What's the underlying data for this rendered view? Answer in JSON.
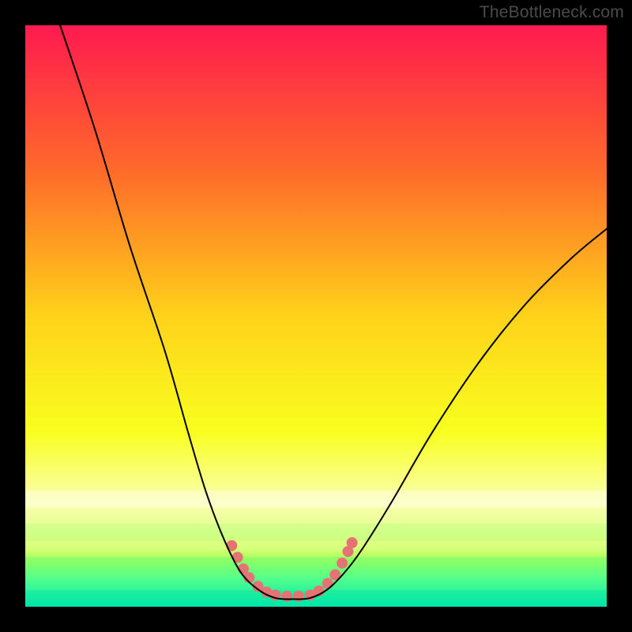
{
  "watermark": "TheBottleneck.com",
  "chart_data": {
    "type": "line",
    "title": "",
    "xlabel": "",
    "ylabel": "",
    "xlim": [
      0,
      100
    ],
    "ylim": [
      0,
      100
    ],
    "background_gradient": {
      "stops": [
        {
          "offset": 0.0,
          "color": "#ff1a4f"
        },
        {
          "offset": 0.25,
          "color": "#ff6a2a"
        },
        {
          "offset": 0.5,
          "color": "#ffd21a"
        },
        {
          "offset": 0.7,
          "color": "#f8ff1f"
        },
        {
          "offset": 0.82,
          "color": "#faffb0"
        },
        {
          "offset": 0.9,
          "color": "#d8ff7a"
        },
        {
          "offset": 0.92,
          "color": "#a8ff55"
        },
        {
          "offset": 0.95,
          "color": "#55ff8a"
        },
        {
          "offset": 1.0,
          "color": "#00e8b0"
        }
      ]
    },
    "green_band": {
      "y0": 94,
      "y1": 100
    },
    "series": [
      {
        "name": "bottleneck-curve",
        "type": "line",
        "stroke": "#000000",
        "stroke_width": 2,
        "points": [
          {
            "x": 6,
            "y": 100
          },
          {
            "x": 12,
            "y": 82
          },
          {
            "x": 18,
            "y": 62
          },
          {
            "x": 24,
            "y": 44
          },
          {
            "x": 28,
            "y": 30
          },
          {
            "x": 31,
            "y": 20
          },
          {
            "x": 34,
            "y": 12
          },
          {
            "x": 37,
            "y": 6
          },
          {
            "x": 40,
            "y": 3
          },
          {
            "x": 43,
            "y": 1.5
          },
          {
            "x": 46,
            "y": 1.3
          },
          {
            "x": 49,
            "y": 1.5
          },
          {
            "x": 52,
            "y": 3
          },
          {
            "x": 55,
            "y": 6
          },
          {
            "x": 58,
            "y": 10
          },
          {
            "x": 63,
            "y": 18
          },
          {
            "x": 70,
            "y": 30
          },
          {
            "x": 78,
            "y": 42
          },
          {
            "x": 86,
            "y": 52
          },
          {
            "x": 94,
            "y": 60
          },
          {
            "x": 100,
            "y": 65
          }
        ]
      },
      {
        "name": "marker-dots",
        "type": "scatter",
        "color": "#e57373",
        "radius": 7,
        "points": [
          {
            "x": 35.5,
            "y": 10.5
          },
          {
            "x": 36.5,
            "y": 8.5
          },
          {
            "x": 37.5,
            "y": 6.5
          },
          {
            "x": 38.5,
            "y": 5
          },
          {
            "x": 40,
            "y": 3.5
          },
          {
            "x": 41.5,
            "y": 2.5
          },
          {
            "x": 43,
            "y": 2
          },
          {
            "x": 45,
            "y": 1.8
          },
          {
            "x": 47,
            "y": 1.8
          },
          {
            "x": 49,
            "y": 2
          },
          {
            "x": 50.5,
            "y": 2.7
          },
          {
            "x": 52,
            "y": 4
          },
          {
            "x": 53.3,
            "y": 5.5
          },
          {
            "x": 54.5,
            "y": 7.5
          },
          {
            "x": 55.5,
            "y": 9.5
          },
          {
            "x": 56.2,
            "y": 11
          }
        ]
      }
    ]
  }
}
